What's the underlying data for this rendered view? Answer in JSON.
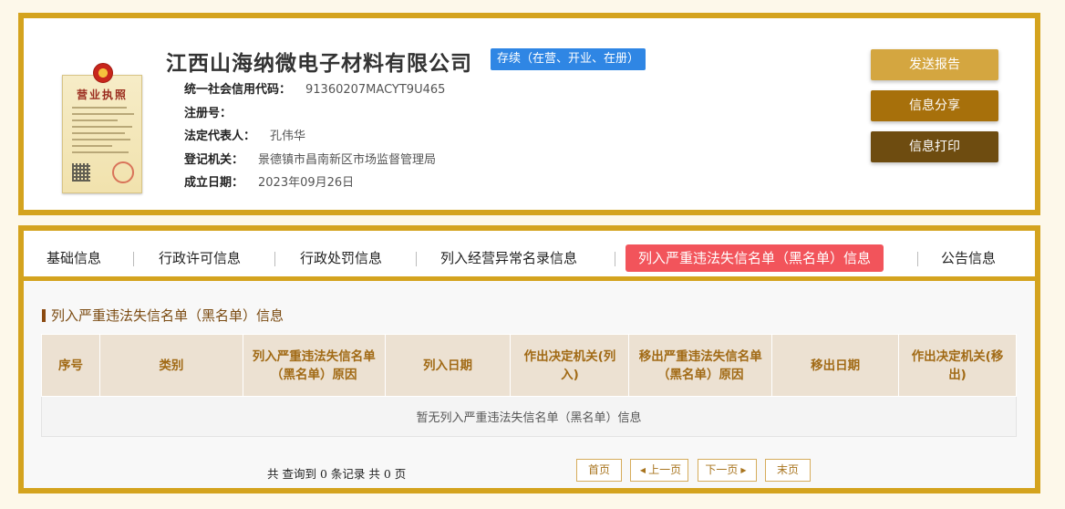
{
  "company": {
    "name": "江西山海纳微电子材料有限公司",
    "status": "存续（在营、开业、在册）",
    "license_title": "营业执照",
    "fields": [
      {
        "label": "统一社会信用代码：",
        "value": "91360207MACYT9U465"
      },
      {
        "label": "注册号：",
        "value": ""
      },
      {
        "label": "法定代表人：",
        "value": "孔伟华"
      },
      {
        "label": "登记机关：",
        "value": "景德镇市昌南新区市场监督管理局"
      },
      {
        "label": "成立日期：",
        "value": "2023年09月26日"
      }
    ]
  },
  "actions": {
    "report": "发送报告",
    "share": "信息分享",
    "print": "信息打印"
  },
  "tabs": [
    {
      "label": "基础信息"
    },
    {
      "label": "行政许可信息"
    },
    {
      "label": "行政处罚信息"
    },
    {
      "label": "列入经营异常名录信息"
    },
    {
      "label": "列入严重违法失信名单（黑名单）信息",
      "active": true
    },
    {
      "label": "公告信息"
    }
  ],
  "section": {
    "title": "列入严重违法失信名单（黑名单）信息",
    "columns": [
      "序号",
      "类别",
      "列入严重违法失信名单（黑名单）原因",
      "列入日期",
      "作出决定机关(列入)",
      "移出严重违法失信名单（黑名单）原因",
      "移出日期",
      "作出决定机关(移出)"
    ],
    "empty_text": "暂无列入严重违法失信名单（黑名单）信息"
  },
  "pagination": {
    "summary": "共 查询到 0 条记录 共 0 页",
    "first": "首页",
    "prev": "上一页",
    "next": "下一页",
    "last": "末页"
  },
  "colors": {
    "border_gold": "#d4a31e",
    "btn_report": "#d4a640",
    "btn_share": "#a7700b",
    "btn_print": "#6e4c10",
    "tab_active": "#f2545b",
    "status_blue": "#2f86e4"
  }
}
